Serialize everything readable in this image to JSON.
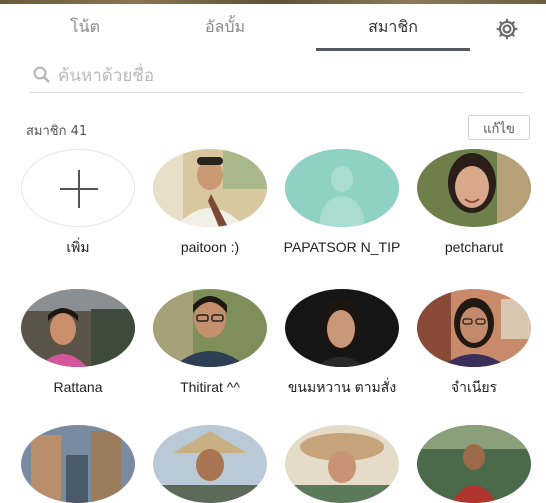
{
  "tabs": [
    {
      "label": "โน้ต"
    },
    {
      "label": "อัลบั้ม"
    },
    {
      "label": "สมาชิก"
    }
  ],
  "search": {
    "placeholder": "ค้นหาด้วยชื่อ"
  },
  "members": {
    "count_label": "สมาชิก 41",
    "edit_label": "แก้ไข",
    "add_label": "เพิ่ม",
    "list": [
      {
        "name": "paitoon :)"
      },
      {
        "name": "PAPATSOR N_TIP"
      },
      {
        "name": "petcharut"
      },
      {
        "name": "Rattana"
      },
      {
        "name": "Thitirat ^^"
      },
      {
        "name": "ขนมหวาน ตามสั่ง"
      },
      {
        "name": "จำเนียร"
      }
    ]
  },
  "colors": {
    "accent_underline": "#55595f",
    "default_avatar": "#8fd1c2"
  },
  "icons": [
    "gear-icon",
    "search-icon",
    "plus-icon",
    "default-avatar-icon"
  ]
}
